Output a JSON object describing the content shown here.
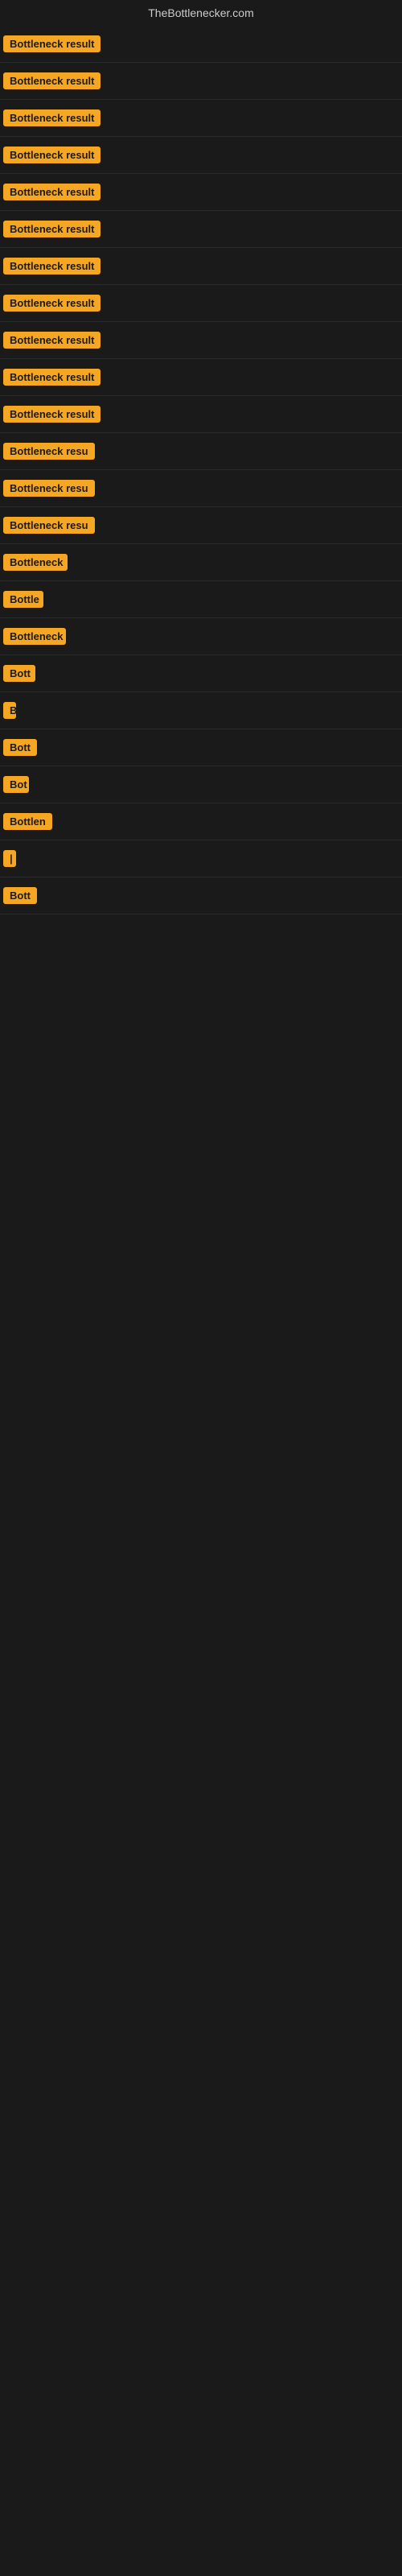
{
  "site": {
    "title": "TheBottlenecker.com"
  },
  "rows": [
    {
      "id": 1,
      "label": "Bottleneck result",
      "visible_chars": 16
    },
    {
      "id": 2,
      "label": "Bottleneck result",
      "visible_chars": 16
    },
    {
      "id": 3,
      "label": "Bottleneck result",
      "visible_chars": 16
    },
    {
      "id": 4,
      "label": "Bottleneck result",
      "visible_chars": 16
    },
    {
      "id": 5,
      "label": "Bottleneck result",
      "visible_chars": 16
    },
    {
      "id": 6,
      "label": "Bottleneck result",
      "visible_chars": 16
    },
    {
      "id": 7,
      "label": "Bottleneck result",
      "visible_chars": 16
    },
    {
      "id": 8,
      "label": "Bottleneck result",
      "visible_chars": 16
    },
    {
      "id": 9,
      "label": "Bottleneck result",
      "visible_chars": 16
    },
    {
      "id": 10,
      "label": "Bottleneck result",
      "visible_chars": 16
    },
    {
      "id": 11,
      "label": "Bottleneck result",
      "visible_chars": 16
    },
    {
      "id": 12,
      "label": "Bottleneck resu",
      "visible_chars": 14
    },
    {
      "id": 13,
      "label": "Bottleneck resu",
      "visible_chars": 14
    },
    {
      "id": 14,
      "label": "Bottleneck resu",
      "visible_chars": 14
    },
    {
      "id": 15,
      "label": "Bottleneck",
      "visible_chars": 10
    },
    {
      "id": 16,
      "label": "Bottle",
      "visible_chars": 6
    },
    {
      "id": 17,
      "label": "Bottleneck",
      "visible_chars": 10
    },
    {
      "id": 18,
      "label": "Bott",
      "visible_chars": 4
    },
    {
      "id": 19,
      "label": "B",
      "visible_chars": 1
    },
    {
      "id": 20,
      "label": "Bott",
      "visible_chars": 4
    },
    {
      "id": 21,
      "label": "Bot",
      "visible_chars": 3
    },
    {
      "id": 22,
      "label": "Bottlen",
      "visible_chars": 7
    },
    {
      "id": 23,
      "label": "|",
      "visible_chars": 1
    },
    {
      "id": 24,
      "label": "Bott",
      "visible_chars": 4
    }
  ]
}
